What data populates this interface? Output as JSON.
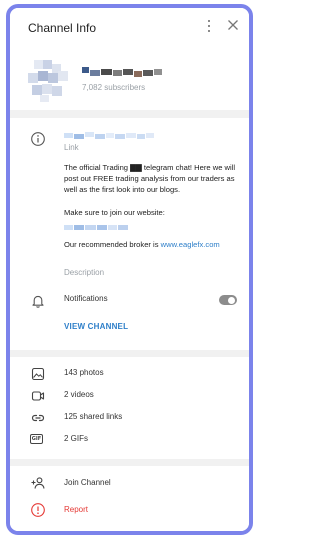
{
  "header": {
    "title": "Channel Info"
  },
  "profile": {
    "subscribers": "7,082 subscribers"
  },
  "info": {
    "link_label": "Link",
    "description": {
      "para1": "The official Trading ▇▇ telegram chat! Here we will post out FREE trading analysis from our traders as well as the first look into our blogs.",
      "para2": "Make sure to join our website:",
      "para3_prefix": "Our recommended broker is ",
      "para3_link": "www.eaglefx.com"
    },
    "description_label": "Description"
  },
  "notifications": {
    "label": "Notifications",
    "enabled": false
  },
  "view_channel_label": "VIEW CHANNEL",
  "media": [
    {
      "icon": "photo-icon",
      "label": "143 photos"
    },
    {
      "icon": "video-icon",
      "label": "2 videos"
    },
    {
      "icon": "link-icon",
      "label": "125 shared links"
    },
    {
      "icon": "gif-icon",
      "label": "2 GIFs",
      "icon_text": "GIF"
    }
  ],
  "actions": {
    "join_label": "Join Channel",
    "report_label": "Report",
    "report_color": "#e53935"
  },
  "colors": {
    "accent": "#2e7fc9",
    "frame": "#7b83eb"
  }
}
